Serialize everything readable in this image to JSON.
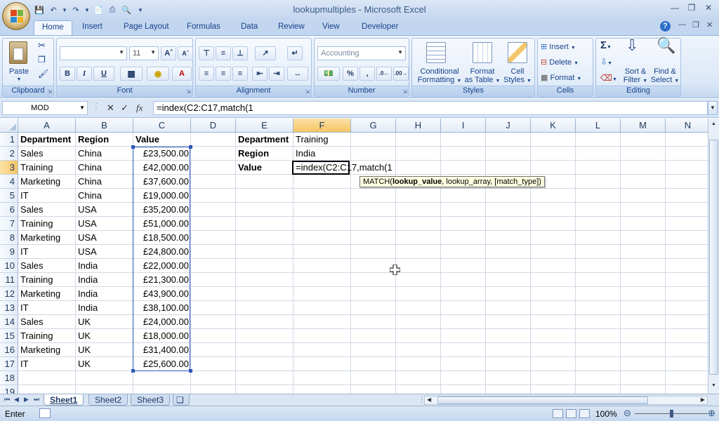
{
  "window": {
    "title": "lookupmultiples - Microsoft Excel"
  },
  "ribbon": {
    "tabs": [
      "Home",
      "Insert",
      "Page Layout",
      "Formulas",
      "Data",
      "Review",
      "View",
      "Developer"
    ],
    "clipboard": {
      "label": "Clipboard",
      "paste": "Paste"
    },
    "font": {
      "label": "Font",
      "name_value": "",
      "size_value": "11",
      "bold": "B",
      "italic": "I",
      "underline": "U"
    },
    "alignment": {
      "label": "Alignment"
    },
    "number": {
      "label": "Number",
      "format_value": "Accounting",
      "percent": "%",
      "comma": ","
    },
    "styles": {
      "label": "Styles",
      "conditional": [
        "Conditional",
        "Formatting"
      ],
      "format_table": [
        "Format",
        "as Table"
      ],
      "cell_styles": [
        "Cell",
        "Styles"
      ]
    },
    "cells": {
      "label": "Cells",
      "insert": "Insert",
      "delete": "Delete",
      "format": "Format"
    },
    "editing": {
      "label": "Editing",
      "sort": [
        "Sort &",
        "Filter"
      ],
      "find": [
        "Find &",
        "Select"
      ]
    }
  },
  "formula_bar": {
    "name_box": "MOD",
    "fx": "fx",
    "formula": "=index(C2:C17,match(1"
  },
  "grid": {
    "columns": [
      "A",
      "B",
      "C",
      "D",
      "E",
      "F",
      "G",
      "H",
      "I",
      "J",
      "K",
      "L",
      "M",
      "N"
    ],
    "rows": [
      "1",
      "2",
      "3",
      "4",
      "5",
      "6",
      "7",
      "8",
      "9",
      "10",
      "11",
      "12",
      "13",
      "14",
      "15",
      "16",
      "17",
      "18",
      "19"
    ],
    "table_header": [
      "Department",
      "Region",
      "Value"
    ],
    "table_rows": [
      [
        "Sales",
        "China",
        "£23,500.00"
      ],
      [
        "Training",
        "China",
        "£42,000.00"
      ],
      [
        "Marketing",
        "China",
        "£37,600.00"
      ],
      [
        "IT",
        "China",
        "£19,000.00"
      ],
      [
        "Sales",
        "USA",
        "£35,200.00"
      ],
      [
        "Training",
        "USA",
        "£51,000.00"
      ],
      [
        "Marketing",
        "USA",
        "£18,500.00"
      ],
      [
        "IT",
        "USA",
        "£24,800.00"
      ],
      [
        "Sales",
        "India",
        "£22,000.00"
      ],
      [
        "Training",
        "India",
        "£21,300.00"
      ],
      [
        "Marketing",
        "India",
        "£43,900.00"
      ],
      [
        "IT",
        "India",
        "£38,100.00"
      ],
      [
        "Sales",
        "UK",
        "£24,000.00"
      ],
      [
        "Training",
        "UK",
        "£18,000.00"
      ],
      [
        "Marketing",
        "UK",
        "£31,400.00"
      ],
      [
        "IT",
        "UK",
        "£25,600.00"
      ]
    ],
    "lookup": [
      {
        "label": "Department",
        "value": "Training"
      },
      {
        "label": "Region",
        "value": "India"
      },
      {
        "label": "Value",
        "value": "=index(C2:C17,match(1"
      }
    ],
    "tooltip": {
      "fn": "MATCH(",
      "arg1": "lookup_value",
      "rest": ", lookup_array, [match_type])"
    }
  },
  "sheets": [
    "Sheet1",
    "Sheet2",
    "Sheet3"
  ],
  "status": {
    "mode": "Enter",
    "zoom": "100%"
  }
}
